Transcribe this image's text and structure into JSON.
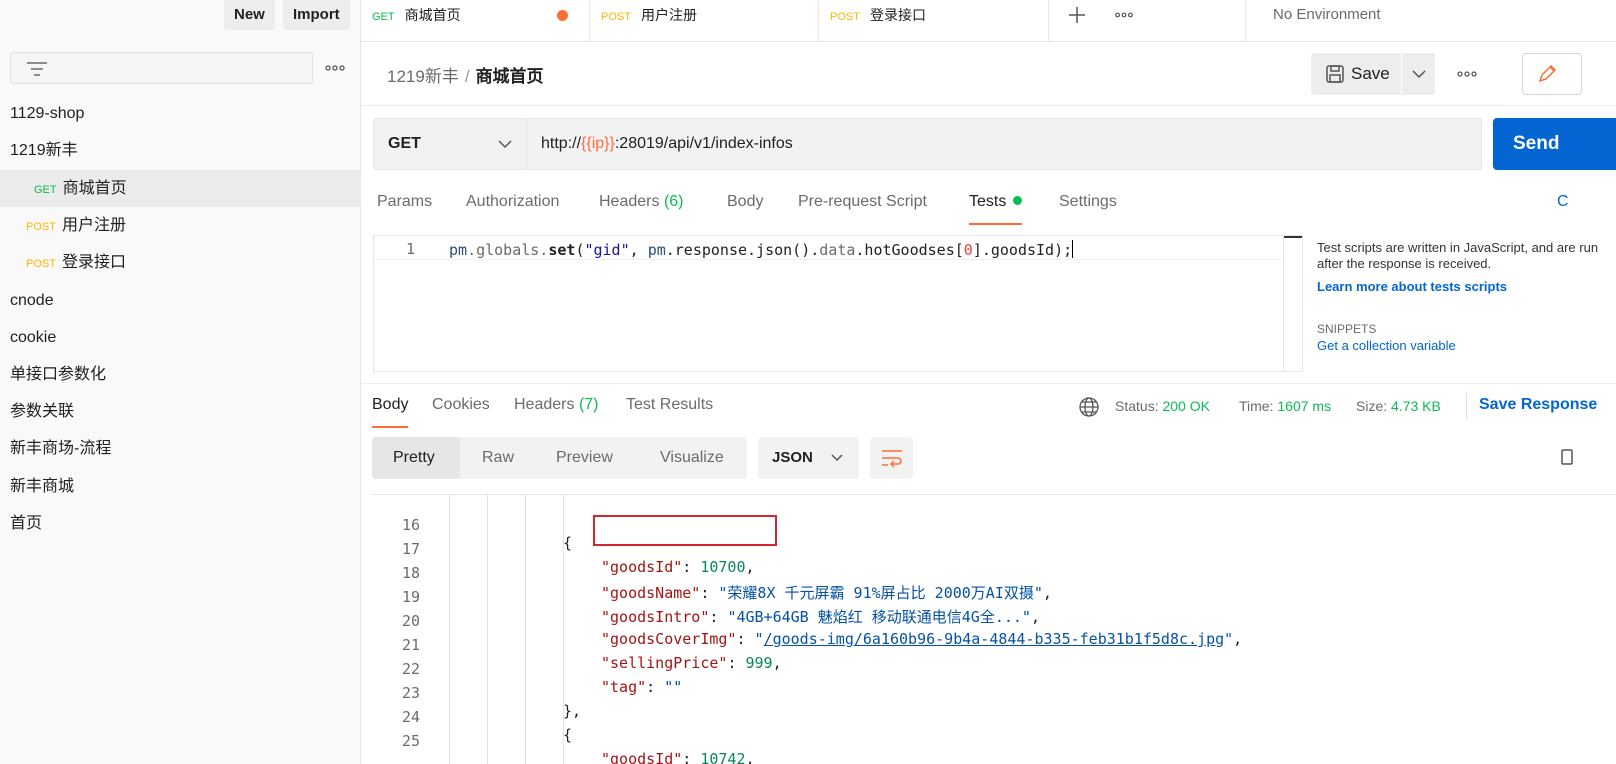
{
  "sidebar": {
    "new_label": "New",
    "import_label": "Import",
    "items": [
      {
        "label": "1129-shop"
      },
      {
        "label": "1219新丰"
      },
      {
        "method": "GET",
        "label": "商城首页"
      },
      {
        "method": "POST",
        "label": "用户注册"
      },
      {
        "method": "POST",
        "label": "登录接口"
      },
      {
        "label": "cnode"
      },
      {
        "label": "cookie"
      },
      {
        "label": "单接口参数化"
      },
      {
        "label": "参数关联"
      },
      {
        "label": "新丰商场-流程"
      },
      {
        "label": "新丰商城"
      },
      {
        "label": "首页"
      }
    ]
  },
  "tabs": [
    {
      "method": "GET",
      "label": "商城首页"
    },
    {
      "method": "POST",
      "label": "用户注册"
    },
    {
      "method": "POST",
      "label": "登录接口"
    }
  ],
  "environment": "No Environment",
  "breadcrumb": {
    "parent": "1219新丰",
    "sep": "/",
    "current": "商城首页"
  },
  "header": {
    "save_label": "Save"
  },
  "request": {
    "method": "GET",
    "url_prefix": "http://",
    "url_var": "{{ip}}",
    "url_suffix": ":28019/api/v1/index-infos",
    "send_label": "Send"
  },
  "request_tabs": {
    "params": "Params",
    "authorization": "Authorization",
    "headers": "Headers",
    "headers_count": "(6)",
    "body": "Body",
    "prerequest": "Pre-request Script",
    "tests": "Tests",
    "settings": "Settings",
    "cookies_partial": "C"
  },
  "editor": {
    "line_no": "1",
    "code": {
      "p1": "pm",
      "p2": ".globals.",
      "p3": "set",
      "p4": "(",
      "p5": "\"gid\"",
      "p6": ", ",
      "p7": "pm",
      "p8": ".response.json().",
      "p9": "data",
      "p10": ".hotGoodses[",
      "p11": "0",
      "p12": "].goodsId);"
    }
  },
  "helper": {
    "text": "Test scripts are written in JavaScript, and are run after the response is received.",
    "link": "Learn more about tests scripts",
    "snippets_title": "SNIPPETS",
    "snippet": "Get a collection variable"
  },
  "response_tabs": {
    "body": "Body",
    "cookies": "Cookies",
    "headers": "Headers",
    "headers_count": "(7)",
    "test_results": "Test Results"
  },
  "status": {
    "status_label": "Status:",
    "status_value": "200 OK",
    "time_label": "Time:",
    "time_value": "1607 ms",
    "size_label": "Size:",
    "size_value": "4.73 KB",
    "save_response": "Save Response"
  },
  "response_view": {
    "modes": [
      "Pretty",
      "Raw",
      "Preview",
      "Visualize"
    ],
    "format": "JSON"
  },
  "response_lines": [
    {
      "n": "16"
    },
    {
      "n": "17",
      "key": "\"goodsId\"",
      "val": "10700"
    },
    {
      "n": "18",
      "key": "\"goodsName\"",
      "val": "\"荣耀8X 千元屏霸 91%屏占比 2000万AI双摄\""
    },
    {
      "n": "19",
      "key": "\"goodsIntro\"",
      "val": "\"4GB+64GB 魅焰红 移动联通电信4G全...\""
    },
    {
      "n": "20",
      "key": "\"goodsCoverImg\"",
      "val": "/goods-img/6a160b96-9b4a-4844-b335-feb31b1f5d8c.jpg"
    },
    {
      "n": "21",
      "key": "\"sellingPrice\"",
      "val": "999"
    },
    {
      "n": "22",
      "key": "\"tag\"",
      "val": "\"\""
    },
    {
      "n": "23"
    },
    {
      "n": "24"
    },
    {
      "n": "25",
      "key": "\"goodsId\"",
      "val": "10742"
    }
  ]
}
